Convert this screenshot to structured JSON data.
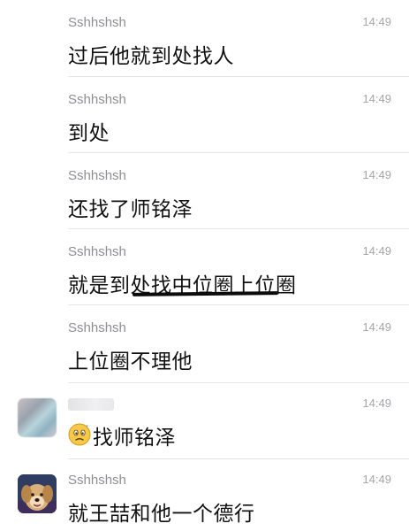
{
  "messages": [
    {
      "sender": "Sshhshsh",
      "time": "14:49",
      "text": "过后他就到处找人"
    },
    {
      "sender": "Sshhshsh",
      "time": "14:49",
      "text": "到处"
    },
    {
      "sender": "Sshhshsh",
      "time": "14:49",
      "text": "还找了师铭泽"
    },
    {
      "sender": "Sshhshsh",
      "time": "14:49",
      "text": "就是到处找中位圈上位圈"
    },
    {
      "sender": "Sshhshsh",
      "time": "14:49",
      "text": "上位圈不理他"
    },
    {
      "sender": "",
      "time": "14:49",
      "text": "找师铭泽",
      "emoji": "confused-face-icon"
    },
    {
      "sender": "Sshhshsh",
      "time": "14:49",
      "text": "就王喆和他一个德行"
    }
  ],
  "colors": {
    "sender": "#8e8e93",
    "time": "#a5a5aa",
    "text": "#111111",
    "divider": "#e6e6e9",
    "underline": "#0b0b0b"
  }
}
